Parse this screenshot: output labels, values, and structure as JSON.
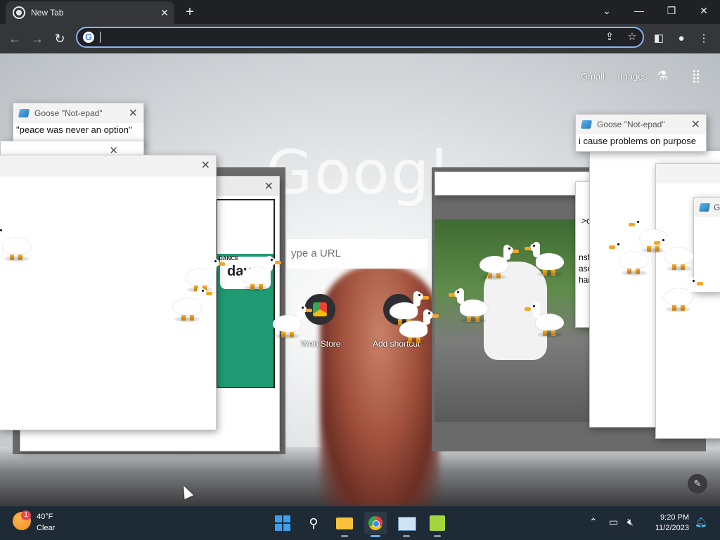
{
  "browser": {
    "tab_title": "New Tab",
    "tab_close": "✕",
    "new_tab": "+",
    "window_controls": {
      "menu": "⌄",
      "minimize": "—",
      "restore": "❐",
      "close": "✕"
    },
    "omnibox_value": "",
    "accent": "#8ab4f8"
  },
  "ntp": {
    "logo": "Googl",
    "links": [
      "Gmail",
      "Images"
    ],
    "search_placeholder": "ype a URL",
    "shortcuts": [
      {
        "label": "Web Store",
        "icon": "chrome-web-store-icon"
      },
      {
        "label": "Add shortcut",
        "icon": "plus-icon"
      }
    ]
  },
  "goose_windows": [
    {
      "title": "Goose \"Not-epad\"",
      "text": "\"peace was never an option\""
    },
    {
      "title": "Goose \"Not-epad\"",
      "text": "i cause problems on purpose"
    },
    {
      "title": "G",
      "text": ""
    }
  ],
  "fragment_texts": [
    ">c",
    "nsf",
    "ase",
    "har"
  ],
  "meme_text": "day",
  "meme_banner": "DANCE",
  "taskbar": {
    "weather": {
      "badge": "1",
      "temp": "40°F",
      "condition": "Clear"
    },
    "apps": [
      "windows-start",
      "search",
      "file-explorer",
      "chrome",
      "task-manager",
      "desktop-goose"
    ],
    "time": "9:20 PM",
    "date": "11/2/2023"
  }
}
